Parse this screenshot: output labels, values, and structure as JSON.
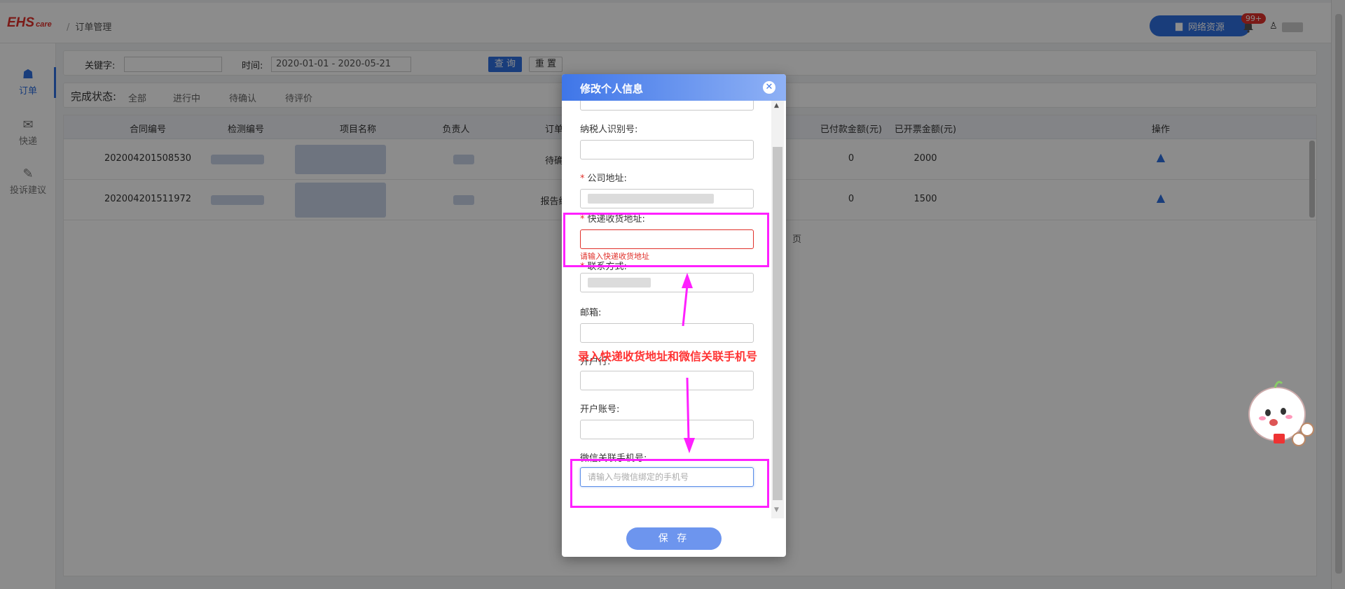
{
  "header": {
    "logo_main": "EHS",
    "logo_sub": "care",
    "breadcrumb_sep": "/",
    "breadcrumb": "订单管理",
    "network_button": "网络资源",
    "notification_badge": "99+"
  },
  "sidebar": {
    "items": [
      {
        "label": "订单",
        "icon": "order-icon",
        "active": true
      },
      {
        "label": "快递",
        "icon": "express-icon",
        "active": false
      },
      {
        "label": "投诉建议",
        "icon": "edit-icon",
        "active": false
      }
    ]
  },
  "filter": {
    "keyword_label": "关键字:",
    "time_label": "时间:",
    "date_range": "2020-01-01 - 2020-05-21",
    "query_button": "查 询",
    "reset_button": "重 置"
  },
  "status_filter": {
    "title": "完成状态:",
    "options": [
      "全部",
      "进行中",
      "待确认",
      "待评价"
    ]
  },
  "table": {
    "headers": [
      "合同编号",
      "检测编号",
      "项目名称",
      "负责人",
      "订单",
      "已付款金额(元)",
      "已开票金额(元)",
      "操作"
    ],
    "rows": [
      {
        "contract_no": "202004201508530",
        "status": "待确",
        "paid": "0",
        "invoiced": "2000"
      },
      {
        "contract_no": "202004201511972",
        "status": "报告编",
        "paid": "0",
        "invoiced": "1500"
      }
    ],
    "pager_text": "页"
  },
  "modal": {
    "title": "修改个人信息",
    "close_icon": "close-icon",
    "fields": [
      {
        "label": "纳税人识别号:",
        "required": false,
        "value": "",
        "placeholder": ""
      },
      {
        "label": "公司地址:",
        "required": true,
        "value": "",
        "placeholder": ""
      },
      {
        "label": "快递收货地址:",
        "required": true,
        "value": "",
        "placeholder": "",
        "error": "请输入快递收货地址"
      },
      {
        "label": "联系方式:",
        "required": true,
        "value": "",
        "placeholder": ""
      },
      {
        "label": "邮箱:",
        "required": false,
        "value": "",
        "placeholder": ""
      },
      {
        "label": "开户行:",
        "required": false,
        "value": "",
        "placeholder": ""
      },
      {
        "label": "开户账号:",
        "required": false,
        "value": "",
        "placeholder": ""
      },
      {
        "label": "微信关联手机号:",
        "required": false,
        "value": "",
        "placeholder": "请输入与微信绑定的手机号"
      }
    ],
    "required_mark": "*",
    "save_button": "保 存"
  },
  "annotation": {
    "text": "录入快递收货地址和微信关联手机号",
    "color": "#ff3333",
    "highlight_color": "#ff20ff"
  },
  "colors": {
    "accent": "#2f6fe0",
    "error": "#e0302a"
  }
}
